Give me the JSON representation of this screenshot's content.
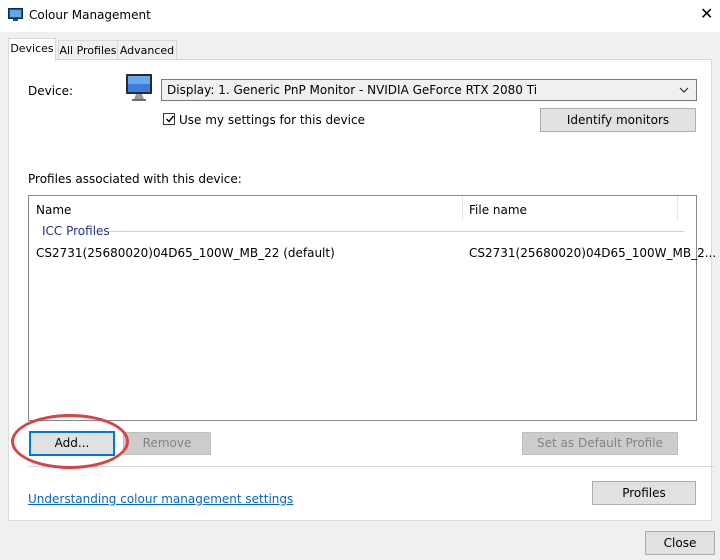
{
  "window": {
    "title": "Colour Management",
    "close_glyph": "✕"
  },
  "tabs": [
    {
      "label": "Devices",
      "active": true
    },
    {
      "label": "All Profiles",
      "active": false
    },
    {
      "label": "Advanced",
      "active": false
    }
  ],
  "device": {
    "label": "Device:",
    "selected": "Display: 1. Generic PnP Monitor - NVIDIA GeForce RTX 2080 Ti",
    "use_my_settings_label": "Use my settings for this device",
    "use_my_settings_checked": true,
    "identify_button": "Identify monitors"
  },
  "profiles": {
    "section_label": "Profiles associated with this device:",
    "columns": [
      "Name",
      "File name"
    ],
    "group": "ICC Profiles",
    "rows": [
      {
        "name": "CS2731(25680020)04D65_100W_MB_22 (default)",
        "file": "CS2731(25680020)04D65_100W_MB_2..."
      }
    ]
  },
  "buttons": {
    "add": "Add...",
    "remove": "Remove",
    "set_default": "Set as Default Profile",
    "profiles": "Profiles",
    "close": "Close"
  },
  "link": "Understanding colour management settings",
  "colors": {
    "accent": "#0078d7",
    "highlight": "#d64545",
    "link": "#0066cc"
  },
  "icons": {
    "app": "colour-management-icon",
    "device": "monitor-icon"
  }
}
